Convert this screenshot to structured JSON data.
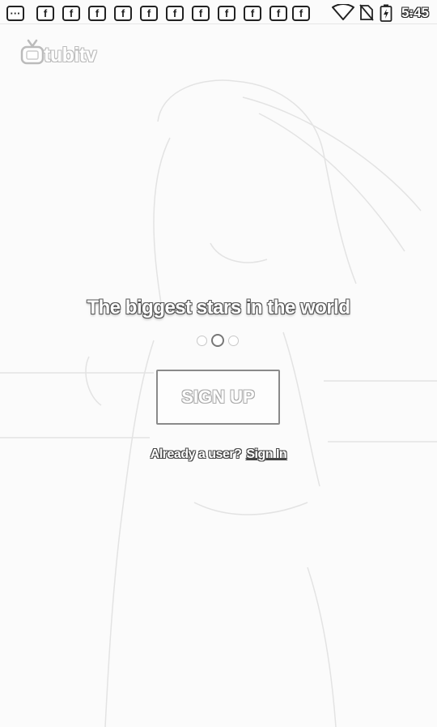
{
  "status_bar": {
    "time": "5:45",
    "notification_icons": [
      "more-notifications-icon",
      "facebook-icon",
      "facebook-icon",
      "facebook-icon",
      "facebook-icon",
      "facebook-icon",
      "facebook-icon",
      "facebook-icon",
      "facebook-icon",
      "facebook-icon",
      "facebook-icon",
      "facebook-icon"
    ],
    "more_glyph": "···",
    "facebook_glyph": "f",
    "system_icons": [
      "wifi-icon",
      "no-sim-icon",
      "battery-charging-icon"
    ]
  },
  "logo": {
    "text": "tubitv"
  },
  "onboarding": {
    "tagline": "The biggest stars in the world",
    "pager": {
      "count": 3,
      "active_index": 1
    }
  },
  "signup": {
    "label": "SIGN UP"
  },
  "signin": {
    "prompt": "Already a user?",
    "link": "Sign In"
  }
}
